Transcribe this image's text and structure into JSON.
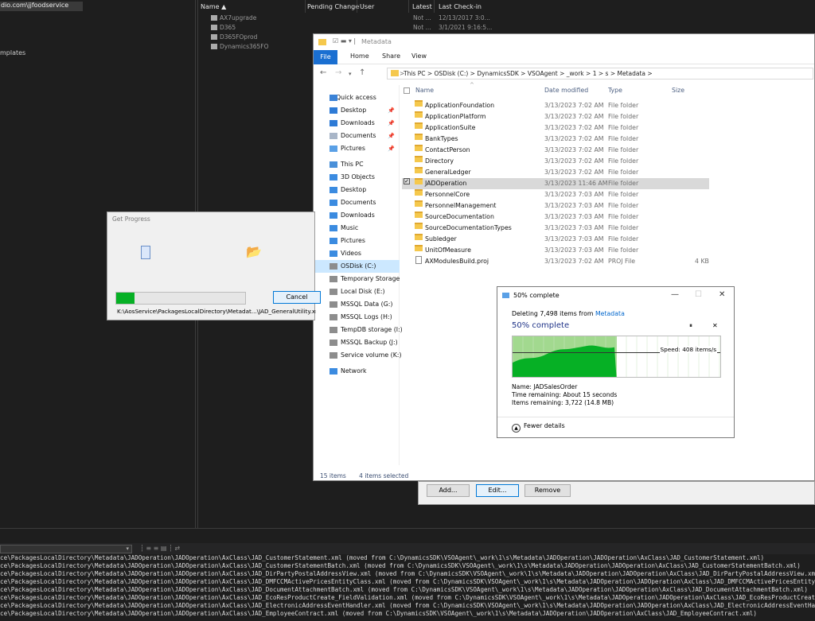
{
  "vs": {
    "workspace_item": "dio.com\\jjfoodservice",
    "templates_label": "mplates",
    "columns": {
      "name": "Name",
      "pending": "Pending Change",
      "user": "User",
      "latest": "Latest",
      "last_checkin": "Last Check-in"
    },
    "items": [
      {
        "name": "AX7upgrade",
        "latest": "Not ...",
        "checkin": "12/13/2017 3:0..."
      },
      {
        "name": "D365",
        "latest": "Not ...",
        "checkin": "3/1/2021 9:16:5..."
      },
      {
        "name": "D365FOprod",
        "latest": "",
        "checkin": ""
      },
      {
        "name": "Dynamics365FO",
        "latest": "",
        "checkin": ""
      }
    ],
    "output_lines": [
      "ce\\PackagesLocalDirectory\\Metadata\\JADOperation\\JADOperation\\AxClass\\JAD_CustomerStatement.xml (moved from C:\\DynamicsSDK\\VSOAgent\\_work\\1\\s\\Metadata\\JADOperation\\JADOperation\\AxClass\\JAD_CustomerStatement.xml)",
      "ce\\PackagesLocalDirectory\\Metadata\\JADOperation\\JADOperation\\AxClass\\JAD_CustomerStatementBatch.xml (moved from C:\\DynamicsSDK\\VSOAgent\\_work\\1\\s\\Metadata\\JADOperation\\JADOperation\\AxClass\\JAD_CustomerStatementBatch.xml)",
      "ce\\PackagesLocalDirectory\\Metadata\\JADOperation\\JADOperation\\AxClass\\JAD_DirPartyPostalAddressView.xml (moved from C:\\DynamicsSDK\\VSOAgent\\_work\\1\\s\\Metadata\\JADOperation\\JADOperation\\AxClass\\JAD_DirPartyPostalAddressView.xml)",
      "ce\\PackagesLocalDirectory\\Metadata\\JADOperation\\JADOperation\\AxClass\\JAD_DMFCCMActivePricesEntityClass.xml (moved from C:\\DynamicsSDK\\VSOAgent\\_work\\1\\s\\Metadata\\JADOperation\\JADOperation\\AxClass\\JAD_DMFCCMActivePricesEntityClass.xml)",
      "ce\\PackagesLocalDirectory\\Metadata\\JADOperation\\JADOperation\\AxClass\\JAD_DocumentAttachmentBatch.xml (moved from C:\\DynamicsSDK\\VSOAgent\\_work\\1\\s\\Metadata\\JADOperation\\JADOperation\\AxClass\\JAD_DocumentAttachmentBatch.xml)",
      "ce\\PackagesLocalDirectory\\Metadata\\JADOperation\\JADOperation\\AxClass\\JAD_EcoResProductCreate_FieldValidation.xml (moved from C:\\DynamicsSDK\\VSOAgent\\_work\\1\\s\\Metadata\\JADOperation\\JADOperation\\AxClass\\JAD_EcoResProductCreate_FieldValidation.xml)",
      "ce\\PackagesLocalDirectory\\Metadata\\JADOperation\\JADOperation\\AxClass\\JAD_ElectronicAddressEventHandler.xml (moved from C:\\DynamicsSDK\\VSOAgent\\_work\\1\\s\\Metadata\\JADOperation\\JADOperation\\AxClass\\JAD_ElectronicAddressEventHandler.xml)",
      "ce\\PackagesLocalDirectory\\Metadata\\JADOperation\\JADOperation\\AxClass\\JAD_EmployeeContract.xml (moved from C:\\DynamicsSDK\\VSOAgent\\_work\\1\\s\\Metadata\\JADOperation\\JADOperation\\AxClass\\JAD_EmployeeContract.xml)"
    ]
  },
  "explorer": {
    "title": "Metadata",
    "tabs": [
      "File",
      "Home",
      "Share",
      "View"
    ],
    "breadcrumb": "This PC  >  OSDisk (C:)  >  DynamicsSDK  >  VSOAgent  >  _work  >  1  >  s  >  Metadata  >",
    "nav": {
      "quick_access": "Quick access",
      "quick": [
        "Desktop",
        "Downloads",
        "Documents",
        "Pictures"
      ],
      "this_pc": "This PC",
      "pc": [
        "3D Objects",
        "Desktop",
        "Documents",
        "Downloads",
        "Music",
        "Pictures",
        "Videos",
        "OSDisk (C:)",
        "Temporary Storage",
        "Local Disk (E:)",
        "MSSQL Data (G:)",
        "MSSQL Logs (H:)",
        "TempDB storage (I:)",
        "MSSQL Backup (J:)",
        "Service volume (K:)"
      ],
      "network": "Network"
    },
    "columns": {
      "name": "Name",
      "date": "Date modified",
      "type": "Type",
      "size": "Size"
    },
    "files": [
      {
        "name": "ApplicationFoundation",
        "date": "3/13/2023 7:02 AM",
        "type": "File folder",
        "size": ""
      },
      {
        "name": "ApplicationPlatform",
        "date": "3/13/2023 7:02 AM",
        "type": "File folder",
        "size": ""
      },
      {
        "name": "ApplicationSuite",
        "date": "3/13/2023 7:02 AM",
        "type": "File folder",
        "size": ""
      },
      {
        "name": "BankTypes",
        "date": "3/13/2023 7:02 AM",
        "type": "File folder",
        "size": ""
      },
      {
        "name": "ContactPerson",
        "date": "3/13/2023 7:02 AM",
        "type": "File folder",
        "size": ""
      },
      {
        "name": "Directory",
        "date": "3/13/2023 7:02 AM",
        "type": "File folder",
        "size": ""
      },
      {
        "name": "GeneralLedger",
        "date": "3/13/2023 7:02 AM",
        "type": "File folder",
        "size": ""
      },
      {
        "name": "JADOperation",
        "date": "3/13/2023 11:46 AM",
        "type": "File folder",
        "size": ""
      },
      {
        "name": "PersonnelCore",
        "date": "3/13/2023 7:03 AM",
        "type": "File folder",
        "size": ""
      },
      {
        "name": "PersonnelManagement",
        "date": "3/13/2023 7:03 AM",
        "type": "File folder",
        "size": ""
      },
      {
        "name": "SourceDocumentation",
        "date": "3/13/2023 7:03 AM",
        "type": "File folder",
        "size": ""
      },
      {
        "name": "SourceDocumentationTypes",
        "date": "3/13/2023 7:03 AM",
        "type": "File folder",
        "size": ""
      },
      {
        "name": "Subledger",
        "date": "3/13/2023 7:03 AM",
        "type": "File folder",
        "size": ""
      },
      {
        "name": "UnitOfMeasure",
        "date": "3/13/2023 7:03 AM",
        "type": "File folder",
        "size": ""
      },
      {
        "name": "AXModulesBuild.proj",
        "date": "3/13/2023 7:02 AM",
        "type": "PROJ File",
        "size": "4 KB"
      }
    ],
    "status_items": "15 items",
    "status_selected": "4 items selected"
  },
  "get_progress": {
    "title": "Get Progress",
    "progress": 0.14,
    "cancel": "Cancel",
    "path": "K:\\AosService\\PackagesLocalDirectory\\Metadat...\\JAD_GeneralUtility.xml"
  },
  "delete_dialog": {
    "title": "50% complete",
    "desc_prefix": "Deleting 7,498 items from",
    "desc_link": "Metadata",
    "percent_text": "50% complete",
    "pause": "⏸",
    "stop": "✕",
    "speed": "Speed: 408 items/s",
    "progress": 0.5,
    "name": "Name:  JADSalesOrder",
    "time": "Time remaining:  About 15 seconds",
    "items": "Items remaining:  3,722 (14.8 MB)",
    "fewer": "Fewer details"
  },
  "back_dialog": {
    "add": "Add...",
    "edit": "Edit...",
    "remove": "Remove"
  }
}
